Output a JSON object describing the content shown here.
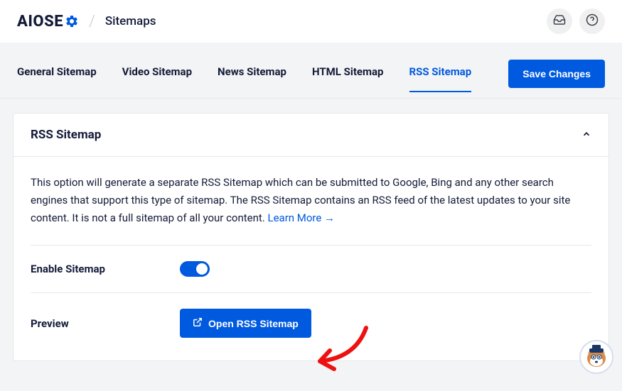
{
  "header": {
    "logo_text_1": "AIOSE",
    "logo_text_2": "",
    "page_title": "Sitemaps"
  },
  "tabs": {
    "general": "General Sitemap",
    "video": "Video Sitemap",
    "news": "News Sitemap",
    "html": "HTML Sitemap",
    "rss": "RSS Sitemap"
  },
  "actions": {
    "save": "Save Changes"
  },
  "panel": {
    "title": "RSS Sitemap",
    "description": "This option will generate a separate RSS Sitemap which can be submitted to Google, Bing and any other search engines that support this type of sitemap. The RSS Sitemap contains an RSS feed of the latest updates to your site content. It is not a full sitemap of all your content. ",
    "learn_more": "Learn More →",
    "enable_label": "Enable Sitemap",
    "preview_label": "Preview",
    "open_button": "Open RSS Sitemap"
  }
}
